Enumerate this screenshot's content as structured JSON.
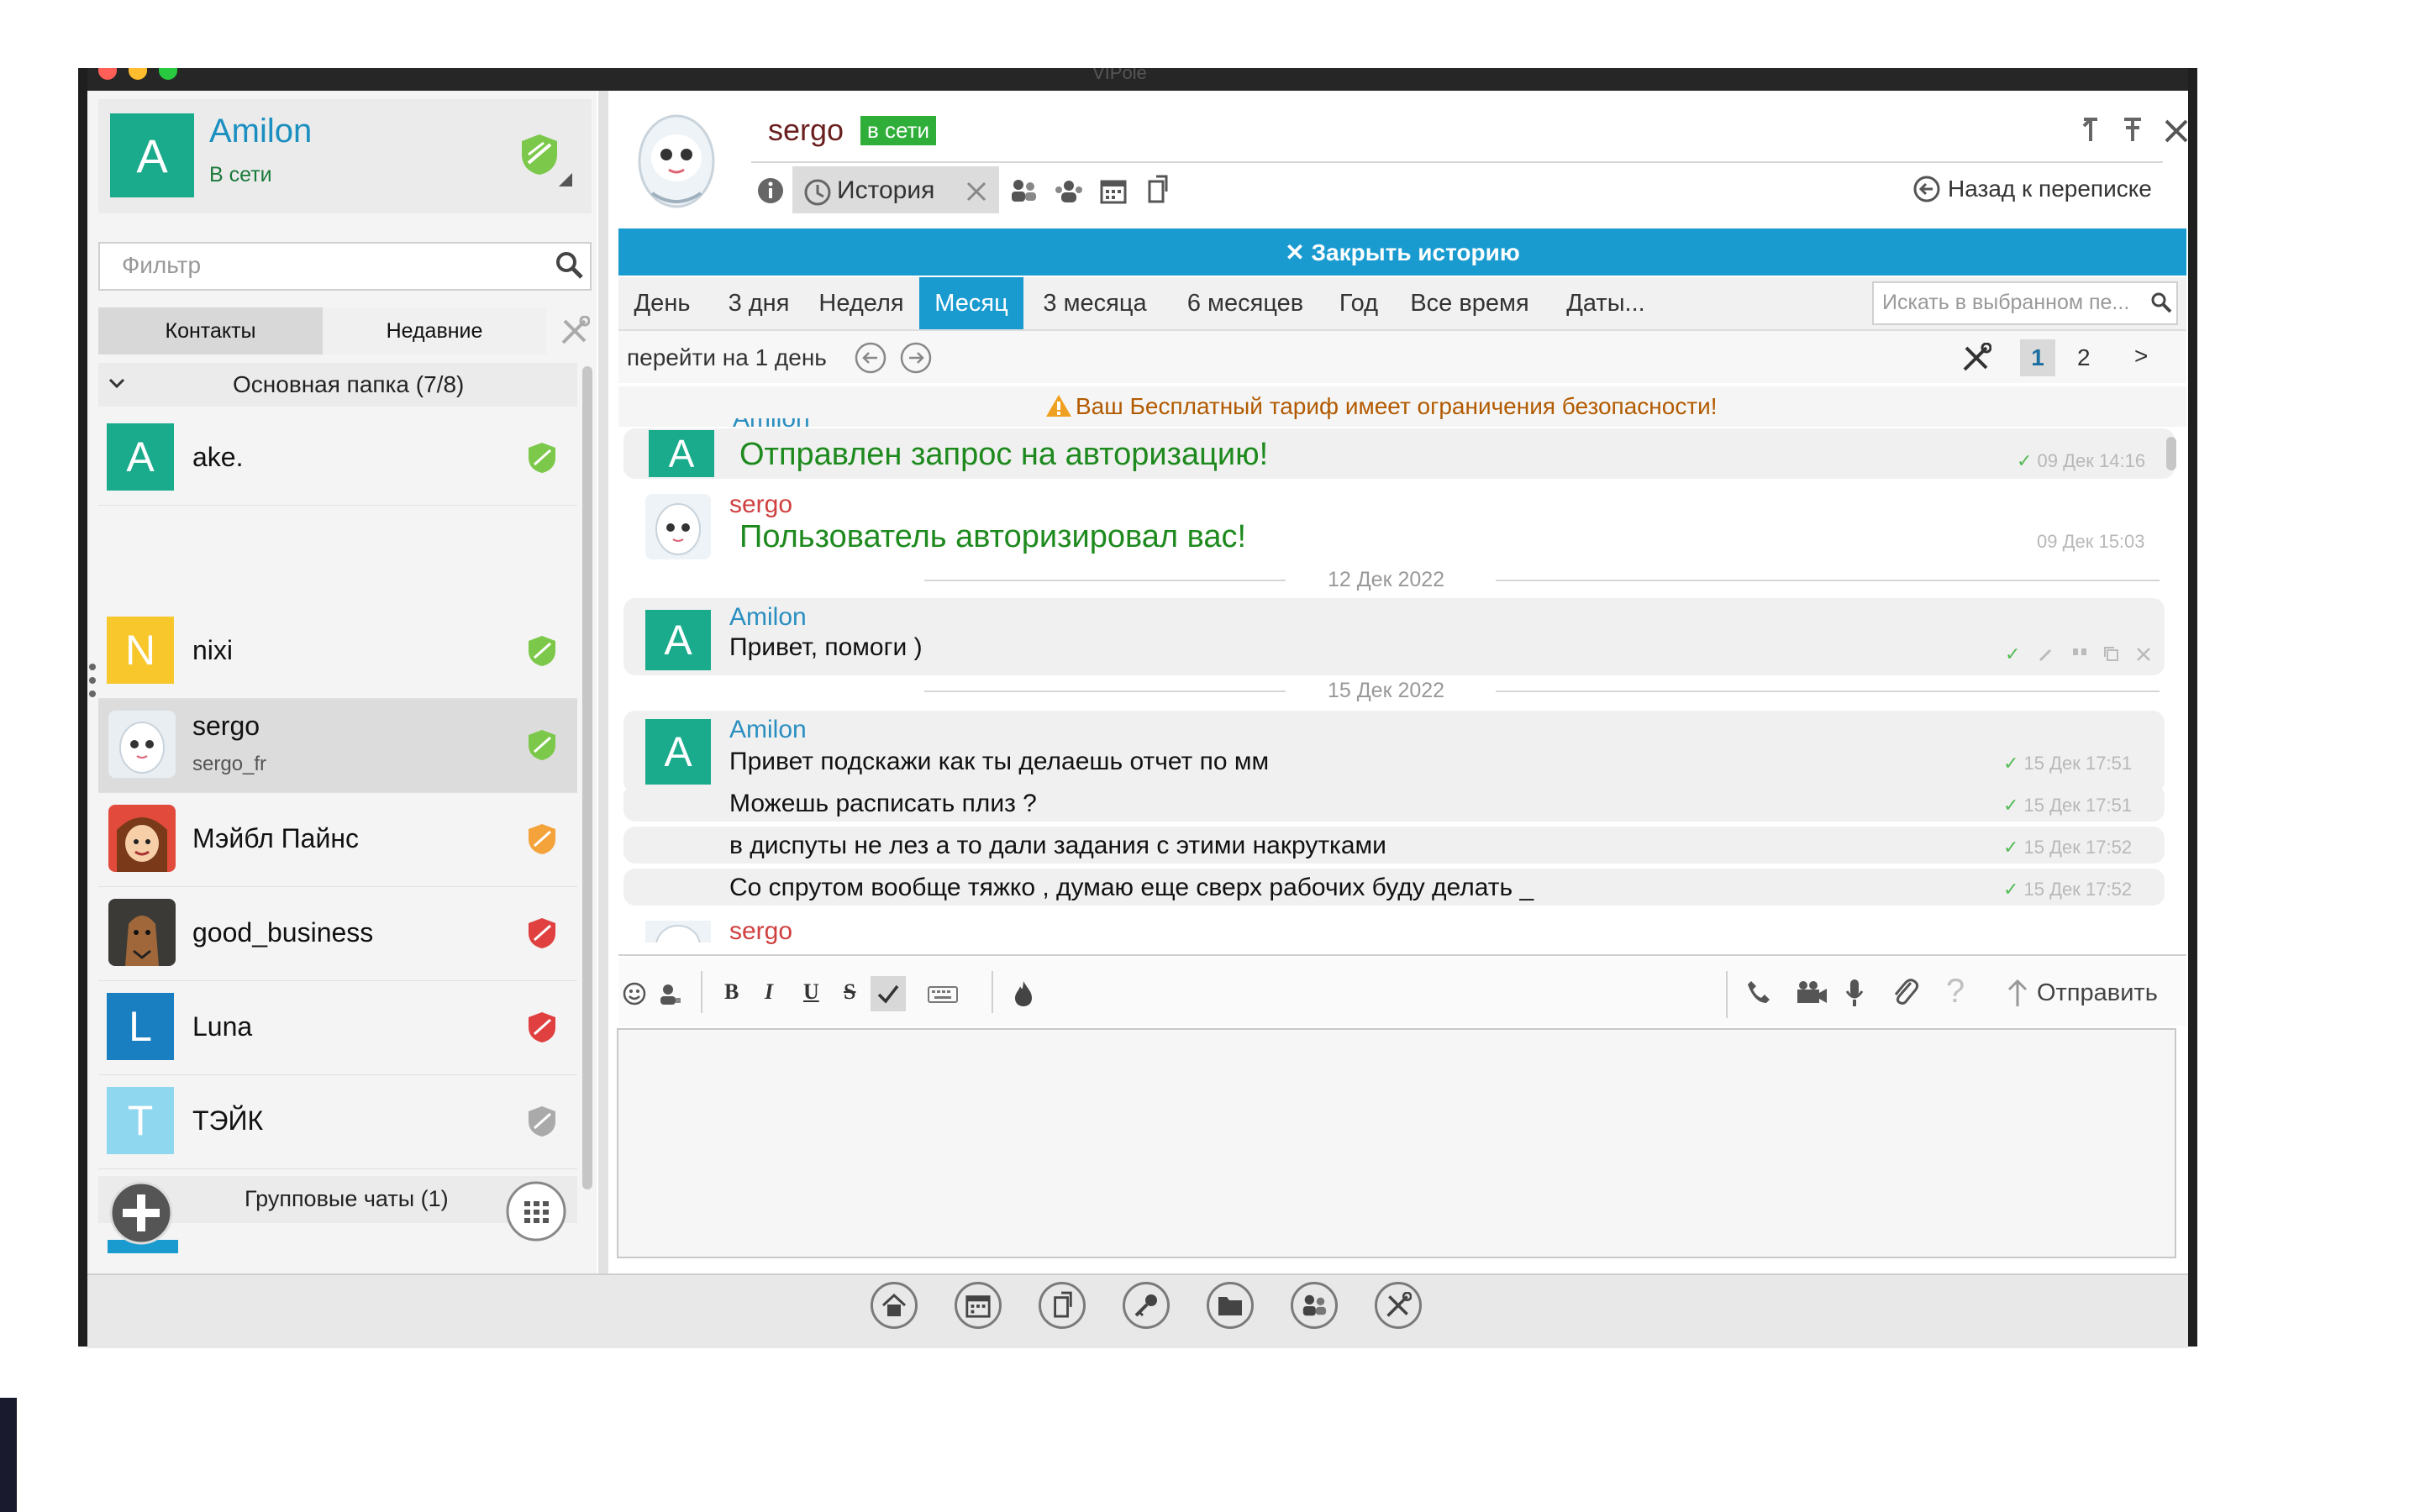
{
  "window": {
    "title": "VIPole"
  },
  "colors": {
    "accent": "#1a9bd0",
    "online": "#2fae3a",
    "teal": "#1aaa8c",
    "yellow": "#f7c72c",
    "blue": "#1a7fc0",
    "lightblue": "#8fd7ef"
  },
  "profile": {
    "avatar_letter": "A",
    "name": "Amilon",
    "status": "В сети"
  },
  "filter": {
    "placeholder": "Фильтр"
  },
  "tabs": {
    "contacts": "Контакты",
    "recent": "Недавние"
  },
  "folder": {
    "label": "Основная папка (7/8)"
  },
  "contacts": [
    {
      "letter": "A",
      "name": "ake.",
      "sub": ""
    },
    {
      "letter": "N",
      "name": "nixi",
      "sub": ""
    },
    {
      "letter": "",
      "name": "sergo",
      "sub": "sergo_fr"
    },
    {
      "letter": "",
      "name": "Мэйбл Пайнс",
      "sub": ""
    },
    {
      "letter": "",
      "name": "good_business",
      "sub": ""
    },
    {
      "letter": "L",
      "name": "Luna",
      "sub": ""
    },
    {
      "letter": "T",
      "name": "ТЭЙК",
      "sub": ""
    }
  ],
  "group_chats": {
    "label": "Групповые чаты (1)"
  },
  "chat_header": {
    "contact_name": "sergo",
    "online_badge": "в сети",
    "history_label": "История",
    "back_label": "Назад к переписке"
  },
  "close_history": "✕ Закрыть историю",
  "periods": [
    "День",
    "3 дня",
    "Неделя",
    "Месяц",
    "3 месяца",
    "6 месяцев",
    "Год",
    "Все время",
    "Даты..."
  ],
  "active_period": "Месяц",
  "history_search": {
    "placeholder": "Искать в выбранном пе..."
  },
  "navigation": {
    "goto": "перейти на 1 день",
    "page_current": "1",
    "page_next_number": "2",
    "page_next": ">"
  },
  "warning": "Ваш Бесплатный тариф имеет ограничения безопасности!",
  "messages": {
    "m1": {
      "author": "Amilon",
      "text": "Отправлен запрос на авторизацию!",
      "time": "09 Дек 14:16"
    },
    "m2": {
      "author": "sergo",
      "text": "Пользователь авторизировал вас!",
      "time": "09 Дек 15:03"
    },
    "date1": "12 Дек 2022",
    "m3": {
      "author": "Amilon",
      "text": "Привет, помоги )"
    },
    "date2": "15 Дек 2022",
    "m4": {
      "author": "Amilon",
      "lines": [
        {
          "text": "Привет подскажи как ты делаешь отчет по мм",
          "time": "15 Дек 17:51"
        },
        {
          "text": "Можешь расписать плиз ?",
          "time": "15 Дек 17:51"
        },
        {
          "text": "в диспуты не лез  а то дали задания с этими накрутками",
          "time": "15 Дек 17:52"
        },
        {
          "text": "Со спрутом вообще тяжко , думаю еще сверх рабочих буду делать _",
          "time": "15 Дек 17:52"
        }
      ]
    },
    "m5": {
      "author": "sergo"
    }
  },
  "composer": {
    "bold": "B",
    "italic": "I",
    "underline": "U",
    "strike": "S",
    "send": "Отправить"
  }
}
